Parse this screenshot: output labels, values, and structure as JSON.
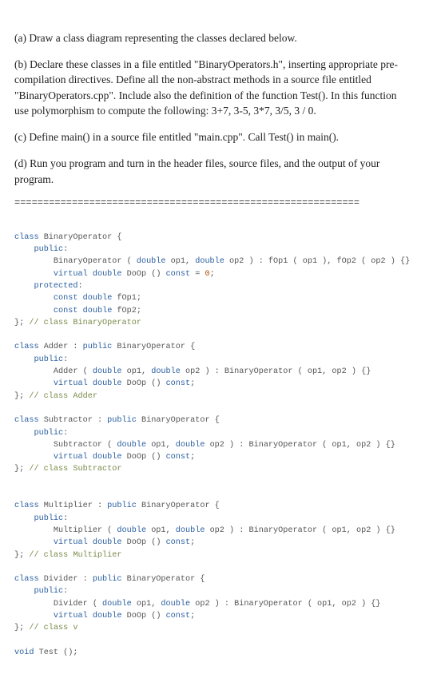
{
  "problem": {
    "a": "(a) Draw a class diagram representing the classes declared below.",
    "b": "(b) Declare these classes in a file entitled \"BinaryOperators.h\", inserting appropriate pre-compilation directives. Define all the non-abstract methods in a source file entitled \"BinaryOperators.cpp\". Include also the definition of the function Test(). In this function use polymorphism to compute the following: 3+7, 3-5, 3*7, 3/5, 3 / 0.",
    "c": "(c) Define main() in a source file entitled \"main.cpp\". Call Test() in main().",
    "d": "(d) Run you program and turn in the header files, source files, and the output of your program."
  },
  "divider": "============================================================",
  "code": {
    "kw_class": "class",
    "kw_public": "public",
    "kw_protected": "protected",
    "kw_virtual": "virtual",
    "kw_const": "const",
    "kw_void": "void",
    "type_double": "double",
    "lit_zero": "0",
    "binop_decl": " BinaryOperator {",
    "binop_pub": ":",
    "binop_ctor": "        BinaryOperator ( ",
    "binop_ctor_mid1": " op1, ",
    "binop_ctor_mid2": " op2 ) : fOp1 ( op1 ), fOp2 ( op2 ) {}",
    "binop_doop_a": " ",
    "binop_doop_b": " DoOp () ",
    "binop_doop_c": " = ",
    "binop_doop_d": ";",
    "binop_prot": ":",
    "binop_f1_a": " ",
    "binop_f1_b": " fOp1;",
    "binop_f2_a": " ",
    "binop_f2_b": " fOp2;",
    "binop_end": "}; ",
    "binop_end_com": "// class BinaryOperator",
    "adder_decl_a": " Adder : ",
    "adder_decl_b": " BinaryOperator {",
    "adder_ctor_a": "        Adder ( ",
    "adder_ctor_b": " op1, ",
    "adder_ctor_c": " op2 ) : BinaryOperator ( op1, op2 ) {}",
    "adder_doop_a": " ",
    "adder_doop_b": " DoOp () ",
    "adder_doop_c": ";",
    "adder_end": "}; ",
    "adder_end_com": "// class Adder",
    "sub_decl_a": " Subtractor : ",
    "sub_decl_b": " BinaryOperator {",
    "sub_ctor_a": "        Subtractor ( ",
    "sub_ctor_b": " op1, ",
    "sub_ctor_c": " op2 ) : BinaryOperator ( op1, op2 ) {}",
    "sub_doop_a": " ",
    "sub_doop_b": " DoOp () ",
    "sub_doop_c": ";",
    "sub_end": "}; ",
    "sub_end_com": "// class Subtractor",
    "mul_decl_a": " Multiplier : ",
    "mul_decl_b": " BinaryOperator {",
    "mul_ctor_a": "        Multiplier ( ",
    "mul_ctor_b": " op1, ",
    "mul_ctor_c": " op2 ) : BinaryOperator ( op1, op2 ) {}",
    "mul_doop_a": " ",
    "mul_doop_b": " DoOp () ",
    "mul_doop_c": ";",
    "mul_end": "}; ",
    "mul_end_com": "// class Multiplier",
    "div_decl_a": " Divider : ",
    "div_decl_b": " BinaryOperator {",
    "div_ctor_a": "        Divider ( ",
    "div_ctor_b": " op1, ",
    "div_ctor_c": " op2 ) : BinaryOperator ( op1, op2 ) {}",
    "div_doop_a": " ",
    "div_doop_b": " DoOp () ",
    "div_doop_c": ";",
    "div_end": "}; ",
    "div_end_com": "// class v",
    "test_decl": " Test ();"
  }
}
